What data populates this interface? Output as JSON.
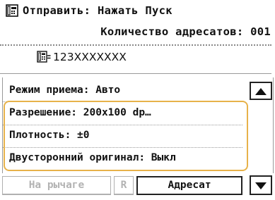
{
  "header": {
    "status": "Отправить: Нажать Пуск",
    "recipients": "Количество адресатов: 001",
    "fax_number": "123XXXXXXX"
  },
  "settings": [
    {
      "label": "Режим приема: Авто"
    },
    {
      "label": "Разрешение: 200x100 dp…"
    },
    {
      "label": "Плотность: ±0"
    },
    {
      "label": "Двусторонний оригинал: Выкл"
    }
  ],
  "footer": {
    "hook_label": "На рычаге",
    "r_label": "R",
    "dest_label": "Адресат"
  },
  "colors": {
    "highlight": "#e7b24a",
    "disabled_text": "#b3b3b3"
  },
  "icons": [
    "fax-icon",
    "up-arrow-icon",
    "down-arrow-icon"
  ]
}
